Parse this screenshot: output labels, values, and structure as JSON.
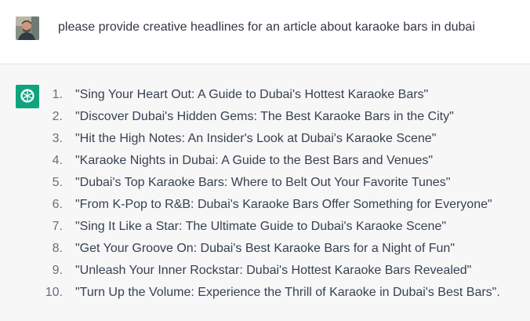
{
  "user_message": {
    "text": "please provide creative headlines for an article about karaoke bars in dubai"
  },
  "assistant_message": {
    "avatar_icon": "openai-logo-icon",
    "avatar_color": "#10a37f",
    "items": [
      {
        "num": "1.",
        "text": "\"Sing Your Heart Out: A Guide to Dubai's Hottest Karaoke Bars\""
      },
      {
        "num": "2.",
        "text": "\"Discover Dubai's Hidden Gems: The Best Karaoke Bars in the City\""
      },
      {
        "num": "3.",
        "text": "\"Hit the High Notes: An Insider's Look at Dubai's Karaoke Scene\""
      },
      {
        "num": "4.",
        "text": "\"Karaoke Nights in Dubai: A Guide to the Best Bars and Venues\""
      },
      {
        "num": "5.",
        "text": "\"Dubai's Top Karaoke Bars: Where to Belt Out Your Favorite Tunes\""
      },
      {
        "num": "6.",
        "text": "\"From K-Pop to R&B: Dubai's Karaoke Bars Offer Something for Everyone\""
      },
      {
        "num": "7.",
        "text": "\"Sing It Like a Star: The Ultimate Guide to Dubai's Karaoke Scene\""
      },
      {
        "num": "8.",
        "text": "\"Get Your Groove On: Dubai's Best Karaoke Bars for a Night of Fun\""
      },
      {
        "num": "9.",
        "text": "\"Unleash Your Inner Rockstar: Dubai's Hottest Karaoke Bars Revealed\""
      },
      {
        "num": "10.",
        "text": "\"Turn Up the Volume: Experience the Thrill of Karaoke in Dubai's Best Bars\"."
      }
    ]
  }
}
